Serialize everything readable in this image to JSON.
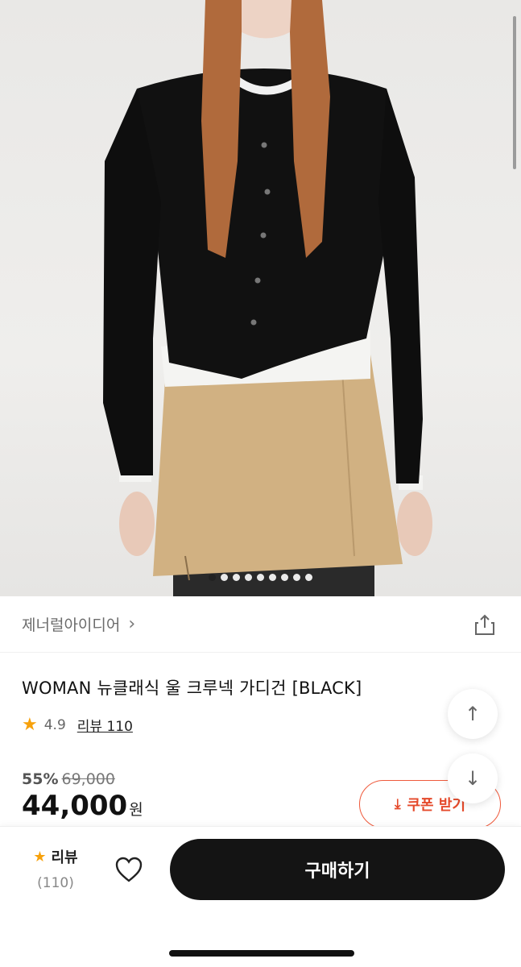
{
  "gallery": {
    "image_alt": "",
    "dot_count": 9,
    "active_index": 0
  },
  "brand": {
    "name": "제너럴아이디어",
    "chevron": "›"
  },
  "product": {
    "title": "WOMAN 뉴클래식 울 크루넥 가디건 [BLACK]",
    "rating": "4.9",
    "review_link": "리뷰 110"
  },
  "price": {
    "discount": "55%",
    "original": "69,000",
    "sale": "44,000",
    "currency": "원"
  },
  "coupon": {
    "label": "쿠폰 받기"
  },
  "float_buttons": {
    "up": "↑",
    "down": "↓"
  },
  "bottom_bar": {
    "review_label": "리뷰",
    "review_count": "(110)",
    "buy_label": "구매하기"
  },
  "colors": {
    "accent": "#e54a2b",
    "star": "#f7a10b",
    "buy_button": "#141414"
  }
}
